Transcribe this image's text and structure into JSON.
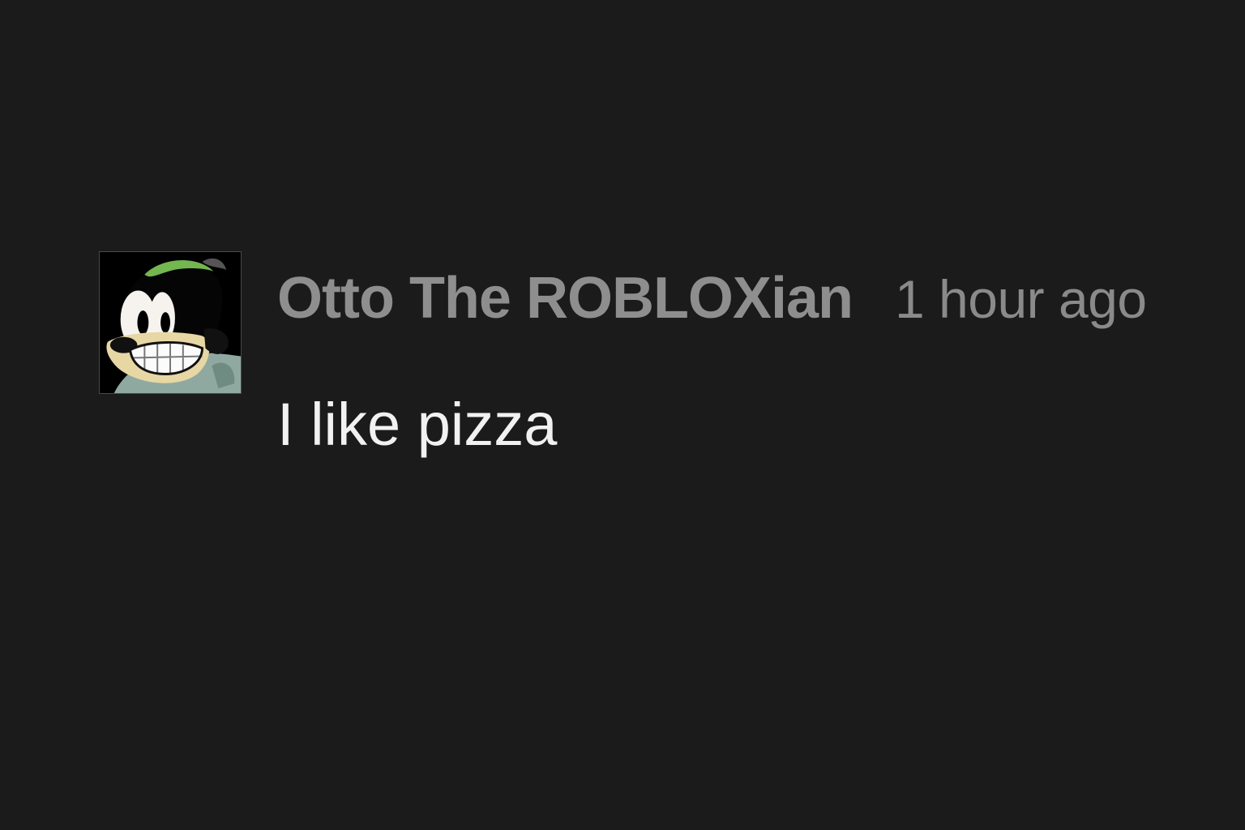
{
  "comment": {
    "author": "Otto The ROBLOXian",
    "timestamp": "1 hour ago",
    "text": "I like pizza",
    "avatar_icon": "cartoon-character-avatar"
  },
  "colors": {
    "background": "#1b1b1b",
    "author_text": "#8e8e8e",
    "timestamp_text": "#8a8a8a",
    "message_text": "#f1f1f1"
  }
}
